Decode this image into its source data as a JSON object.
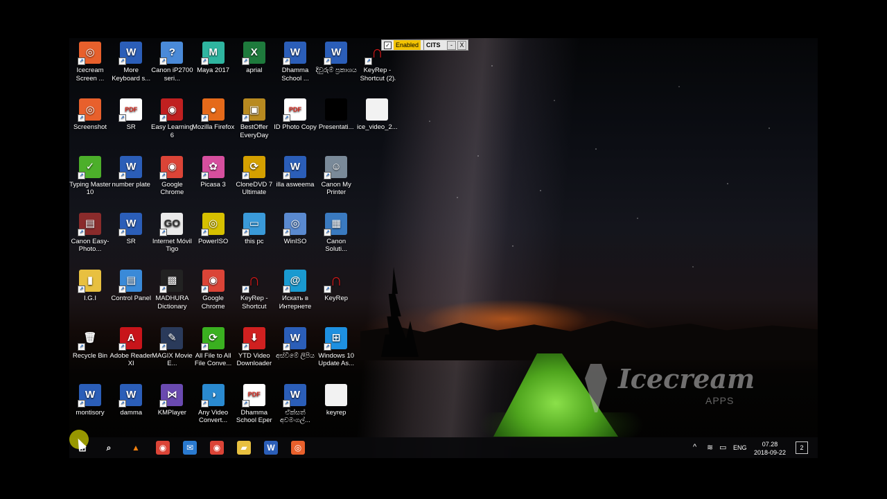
{
  "keyrep_toolbar": {
    "enabled": "Enabled",
    "title": "CITS",
    "minimize": "-",
    "close": "X",
    "check": "✓"
  },
  "desktop_icons": [
    {
      "label": "Icecream Screen ...",
      "glyph": "◎",
      "bg": "#e8602c"
    },
    {
      "label": "More Keyboard s...",
      "glyph": "W",
      "bg": "#2b5eb8"
    },
    {
      "label": "Canon iP2700 seri...",
      "glyph": "?",
      "bg": "#4a8ad8"
    },
    {
      "label": "Maya 2017",
      "glyph": "M",
      "bg": "#2fb5a0"
    },
    {
      "label": "aprial",
      "glyph": "X",
      "bg": "#1e7a3c"
    },
    {
      "label": "Dhamma School ...",
      "glyph": "W",
      "bg": "#2b5eb8"
    },
    {
      "label": "දිවුරුම් ප්‍රකාශය",
      "glyph": "W",
      "bg": "#2b5eb8"
    },
    {
      "label": "KeyRep - Shortcut (2)",
      "glyph": "∩",
      "bg": "transparent"
    },
    {
      "label": "Screenshot",
      "glyph": "◎",
      "bg": "#e8602c"
    },
    {
      "label": "SR",
      "glyph": "PDF",
      "bg": "#d9261c"
    },
    {
      "label": "Easy Learning 6",
      "glyph": "◉",
      "bg": "#c02020"
    },
    {
      "label": "Mozilla Firefox",
      "glyph": "●",
      "bg": "#e56a1a"
    },
    {
      "label": "BestOffer EveryDay",
      "glyph": "▣",
      "bg": "#b88a20"
    },
    {
      "label": "ID Photo Copy",
      "glyph": "PDF",
      "bg": "#d9261c"
    },
    {
      "label": "Presentati...",
      "glyph": "",
      "bg": "#000"
    },
    {
      "label": "ice_video_2...",
      "glyph": "",
      "bg": "#f2f2f2"
    },
    {
      "label": "Typing Master 10",
      "glyph": "✓",
      "bg": "#4caf2a"
    },
    {
      "label": "number plate",
      "glyph": "W",
      "bg": "#2b5eb8"
    },
    {
      "label": "Google Chrome",
      "glyph": "◉",
      "bg": "#db4437"
    },
    {
      "label": "Picasa 3",
      "glyph": "✿",
      "bg": "#d64f9e"
    },
    {
      "label": "CloneDVD 7 Ultimate",
      "glyph": "⟳",
      "bg": "#d4a000"
    },
    {
      "label": "illa asweema",
      "glyph": "W",
      "bg": "#2b5eb8"
    },
    {
      "label": "Canon My Printer",
      "glyph": "☺",
      "bg": "#7a8a99"
    },
    {
      "label": "Canon Easy-Photo...",
      "glyph": "▤",
      "bg": "#8a2b2b"
    },
    {
      "label": "SR",
      "glyph": "W",
      "bg": "#2b5eb8"
    },
    {
      "label": "Internet Móvil Tigo",
      "glyph": "GO",
      "bg": "#eaeaea"
    },
    {
      "label": "PowerISO",
      "glyph": "◎",
      "bg": "#d6c000"
    },
    {
      "label": "this pc",
      "glyph": "▭",
      "bg": "#3a9ad9"
    },
    {
      "label": "WinISO",
      "glyph": "◎",
      "bg": "#5a8ad0"
    },
    {
      "label": "Canon Soluti...",
      "glyph": "▦",
      "bg": "#3a7ac0"
    },
    {
      "label": "I.G.I",
      "glyph": "▮",
      "bg": "#e8c040"
    },
    {
      "label": "Control Panel",
      "glyph": "▤",
      "bg": "#3a8ad8"
    },
    {
      "label": "MADHURA Dictionary",
      "glyph": "▩",
      "bg": "#222"
    },
    {
      "label": "Google Chrome",
      "glyph": "◉",
      "bg": "#db4437"
    },
    {
      "label": "KeyRep - Shortcut",
      "glyph": "∩",
      "bg": "transparent"
    },
    {
      "label": "Искать в Интернете",
      "glyph": "@",
      "bg": "#1a9ad0"
    },
    {
      "label": "KeyRep",
      "glyph": "∩",
      "bg": "transparent"
    },
    {
      "label": "Recycle Bin",
      "glyph": "🗑",
      "bg": "transparent"
    },
    {
      "label": "Adobe Reader XI",
      "glyph": "A",
      "bg": "#c8141a"
    },
    {
      "label": "MAGIX Movie E...",
      "glyph": "✎",
      "bg": "#2a3a5a"
    },
    {
      "label": "All File to All File Conve...",
      "glyph": "⟳",
      "bg": "#3ab020"
    },
    {
      "label": "YTD Video Downloader",
      "glyph": "⬇",
      "bg": "#d02020"
    },
    {
      "label": "අස්විමේ ලිපිය",
      "glyph": "W",
      "bg": "#2b5eb8"
    },
    {
      "label": "Windows 10 Update As...",
      "glyph": "⊞",
      "bg": "#1e90e0"
    },
    {
      "label": "montisory",
      "glyph": "W",
      "bg": "#2b5eb8"
    },
    {
      "label": "damma",
      "glyph": "W",
      "bg": "#2b5eb8"
    },
    {
      "label": "KMPlayer",
      "glyph": "⋈",
      "bg": "#6a4ab0"
    },
    {
      "label": "Any Video Convert...",
      "glyph": "◑",
      "bg": "#2a8ad0"
    },
    {
      "label": "Dhamma School Eper",
      "glyph": "PDF",
      "bg": "#d9261c"
    },
    {
      "label": "ඒක්සත් අවම‍ංගල්...",
      "glyph": "W",
      "bg": "#2b5eb8"
    },
    {
      "label": "keyrep",
      "glyph": "",
      "bg": "#f2f2f2"
    }
  ],
  "taskbar": {
    "apps": [
      {
        "name": "search",
        "glyph": "⌕",
        "bg": "transparent"
      },
      {
        "name": "vlc",
        "glyph": "▲",
        "bg": "transparent"
      },
      {
        "name": "chrome",
        "glyph": "◉",
        "bg": "#db4437"
      },
      {
        "name": "mail",
        "glyph": "✉",
        "bg": "#2a7ad0"
      },
      {
        "name": "chrome2",
        "glyph": "◉",
        "bg": "#db4437"
      },
      {
        "name": "file-explorer",
        "glyph": "▰",
        "bg": "#e8c040"
      },
      {
        "name": "word",
        "glyph": "W",
        "bg": "#2b5eb8"
      },
      {
        "name": "icecream",
        "glyph": "◎",
        "bg": "#e8602c"
      }
    ],
    "tray": {
      "chevron": "^",
      "network": "≋",
      "battery": "▭",
      "language": "ENG",
      "time": "07.28",
      "date": "2018-09-22",
      "notification_count": "2"
    }
  },
  "watermark": {
    "text": "Icecream",
    "sub": "APPS"
  }
}
